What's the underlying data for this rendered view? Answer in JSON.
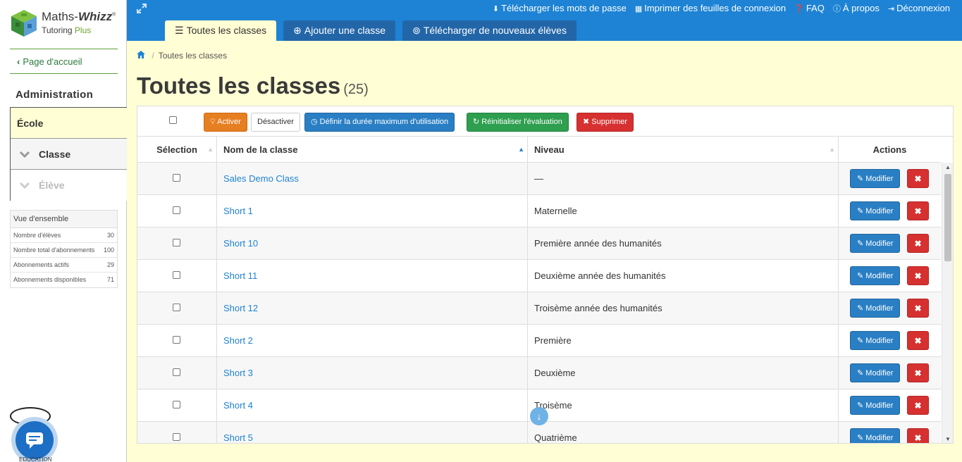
{
  "logo": {
    "name_part1": "Maths-",
    "name_part2": "Whizz",
    "reg": "®",
    "sub_part1": "Tutoring ",
    "sub_part2": "Plus"
  },
  "sidebar": {
    "home_link": "Page d'accueil",
    "admin_title": "Administration",
    "nav": [
      {
        "label": "École"
      },
      {
        "label": "Classe"
      },
      {
        "label": "Élève"
      }
    ],
    "overview": {
      "title": "Vue d'ensemble",
      "rows": [
        {
          "label": "Nombre d'élèves",
          "value": "30"
        },
        {
          "label": "Nombre total d'abonnements",
          "value": "100"
        },
        {
          "label": "Abonnements actifs",
          "value": "29"
        },
        {
          "label": "Abonnements disponibles",
          "value": "71"
        }
      ]
    },
    "edu_label": "EDUCATION"
  },
  "topbar": {
    "links": [
      {
        "icon": "download-icon",
        "label": "Télécharger les mots de passe"
      },
      {
        "icon": "print-icon",
        "label": "Imprimer des feuilles de connexion"
      },
      {
        "icon": "question-icon",
        "label": "FAQ"
      },
      {
        "icon": "info-icon",
        "label": "À propos"
      },
      {
        "icon": "logout-icon",
        "label": "Déconnexion"
      }
    ],
    "tabs": [
      {
        "icon": "list-icon",
        "label": "Toutes les classes",
        "active": true
      },
      {
        "icon": "plus-circle-icon",
        "label": "Ajouter une classe",
        "active": false
      },
      {
        "icon": "upload-circle-icon",
        "label": "Télécharger de nouveaux élèves",
        "active": false
      }
    ]
  },
  "main": {
    "breadcrumb": "Toutes les classes",
    "title": "Toutes les classes",
    "count": "(25)",
    "toolbar": {
      "activate": "Activer",
      "deactivate": "Désactiver",
      "max_duration": "Définir la durée maximum d'utilisation",
      "reset_eval": "Réinitialiser l'évaluation",
      "delete": "Supprimer"
    },
    "columns": {
      "selection": "Sélection",
      "name": "Nom de la classe",
      "level": "Niveau",
      "actions": "Actions"
    },
    "edit_label": "Modifier",
    "rows": [
      {
        "name": "Sales Demo Class",
        "level": "—"
      },
      {
        "name": "Short 1",
        "level": "Maternelle"
      },
      {
        "name": "Short 10",
        "level": "Première année des humanités"
      },
      {
        "name": "Short 11",
        "level": "Deuxième année des humanités"
      },
      {
        "name": "Short 12",
        "level": "Troisème année des humanités"
      },
      {
        "name": "Short 2",
        "level": "Première"
      },
      {
        "name": "Short 3",
        "level": "Deuxième"
      },
      {
        "name": "Short 4",
        "level": "Troisème"
      },
      {
        "name": "Short 5",
        "level": "Quatrième"
      }
    ]
  },
  "colors": {
    "topbar": "#1e83d4",
    "background": "#fffed4",
    "orange": "#e67e22",
    "blue": "#2a7fc4",
    "green": "#2e9e4f",
    "red": "#d63030"
  }
}
